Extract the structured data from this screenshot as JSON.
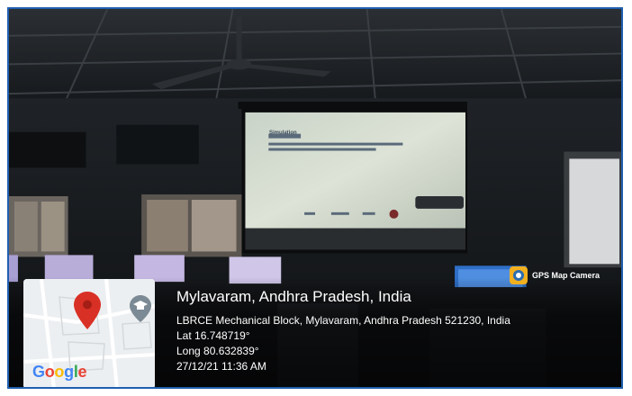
{
  "badge": {
    "icon": "camera-globe-icon",
    "label": "GPS Map Camera"
  },
  "location": {
    "title": "Mylavaram, Andhra Pradesh, India",
    "address": "LBRCE Mechanical Block, Mylavaram, Andhra Pradesh 521230, India",
    "latitude": "Lat 16.748719°",
    "longitude": "Long 80.632839°",
    "datetime": "27/12/21 11:36 AM"
  },
  "map": {
    "brand": "Google",
    "pin_icon": "map-pin-icon",
    "poi_icon": "graduation-cap-icon",
    "pin_color": "#d93025"
  },
  "projection": {
    "heading": "Simulation"
  }
}
